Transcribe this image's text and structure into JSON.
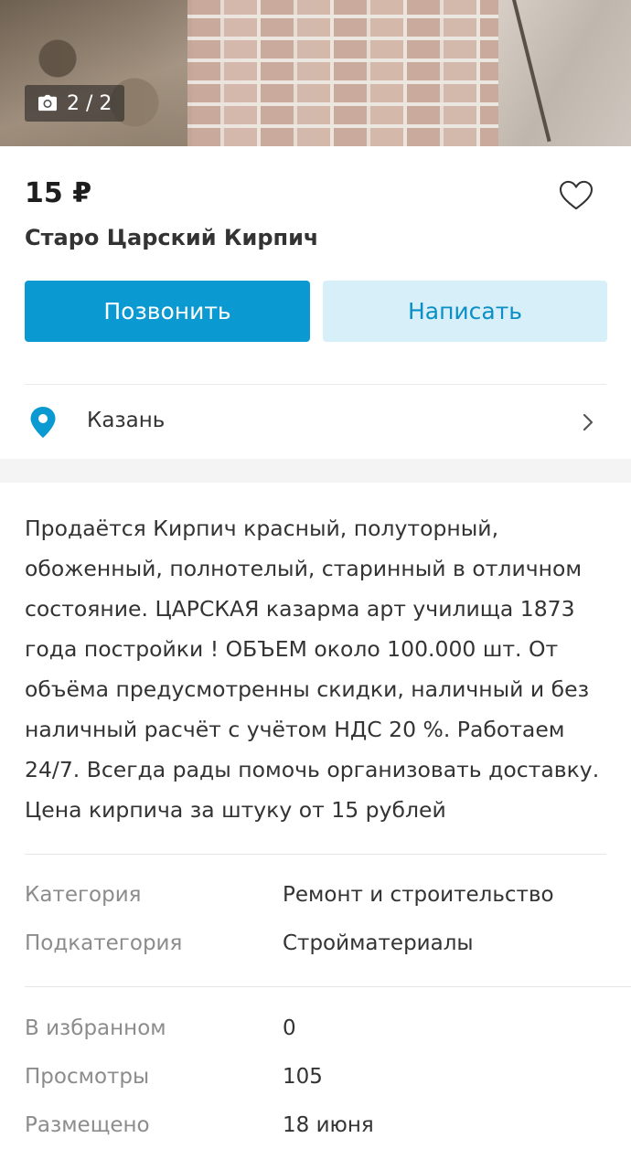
{
  "photo": {
    "counter": "2 / 2",
    "icon": "camera-icon"
  },
  "listing": {
    "price": "15 ₽",
    "title": "Старо Царский Кирпич",
    "call_label": "Позвонить",
    "message_label": "Написать",
    "location": "Казань",
    "description": "Продаётся Кирпич красный, полуторный, обоженный, полнотелый, старинный в отличном состояние. ЦАРСКАЯ казарма арт училища 1873 года постройки ! ОБЪЕМ около 100.000 шт. От объёма предусмотренны скидки, наличный и без наличный расчёт с учётом НДС 20 %. Работаем 24/7. Всегда рады помочь организовать доставку. Цена кирпича за штуку от 15 рублей"
  },
  "params": [
    {
      "key": "Категория",
      "value": "Ремонт и строительство"
    },
    {
      "key": "Подкатегория",
      "value": "Стройматериалы"
    }
  ],
  "stats": [
    {
      "key": "В избранном",
      "value": "0"
    },
    {
      "key": "Просмотры",
      "value": "105"
    },
    {
      "key": "Размещено",
      "value": "18 июня"
    }
  ],
  "colors": {
    "accent": "#0a99d1",
    "accent_light": "#d7eff8"
  }
}
